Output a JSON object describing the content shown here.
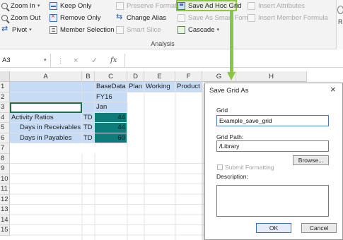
{
  "ribbon": {
    "zoom_in": "Zoom In",
    "zoom_out": "Zoom Out",
    "pivot": "Pivot",
    "keep_only": "Keep Only",
    "remove_only": "Remove Only",
    "member_selection": "Member Selection",
    "preserve_format": "Preserve Format",
    "change_alias": "Change Alias",
    "smart_slice": "Smart Slice",
    "save_ad_hoc_grid": "Save Ad Hoc Grid",
    "save_as_smart_form": "Save As Smart Form",
    "cascade": "Cascade",
    "insert_attributes": "Insert Attributes",
    "insert_member_formula": "Insert Member Formula",
    "group_label": "Analysis",
    "edge_text": "Re",
    "highlight_color": "#8cc63f"
  },
  "formula_bar": {
    "name_box": "A3",
    "cancel_glyph": "×",
    "enter_glyph": "✓",
    "function_glyph": "fx"
  },
  "grid": {
    "columns": [
      "A",
      "B",
      "C",
      "D",
      "E",
      "F",
      "G",
      "H"
    ],
    "rows": [
      "1",
      "2",
      "3",
      "4",
      "5",
      "6",
      "7",
      "8",
      "9",
      "10",
      "11",
      "12",
      "13",
      "14",
      "15"
    ],
    "cells": {
      "c1": "BaseData",
      "d1": "Plan",
      "e1": "Working",
      "f1": "Product",
      "c2": "FY16",
      "c3": "Jan",
      "a4": "Activity Ratios",
      "b4": "TD",
      "c4": "44",
      "a5": "Days in Receivables",
      "b5": "TD",
      "c5": "44",
      "a6": "Days in Payables",
      "b6": "TD",
      "c6": "60"
    },
    "colors": {
      "header_fill": "#c6dbf6",
      "data_fill": "#0e7c7b"
    }
  },
  "dialog": {
    "title": "Save Grid As",
    "close": "×",
    "grid_label": "Grid",
    "grid_value": "Example_save_grid",
    "grid_path_label": "Grid Path:",
    "grid_path_value": "/Library",
    "browse": "Browse...",
    "submit_formatting": "Submit Formatting",
    "description_label": "Description:",
    "ok": "OK",
    "cancel": "Cancel"
  }
}
